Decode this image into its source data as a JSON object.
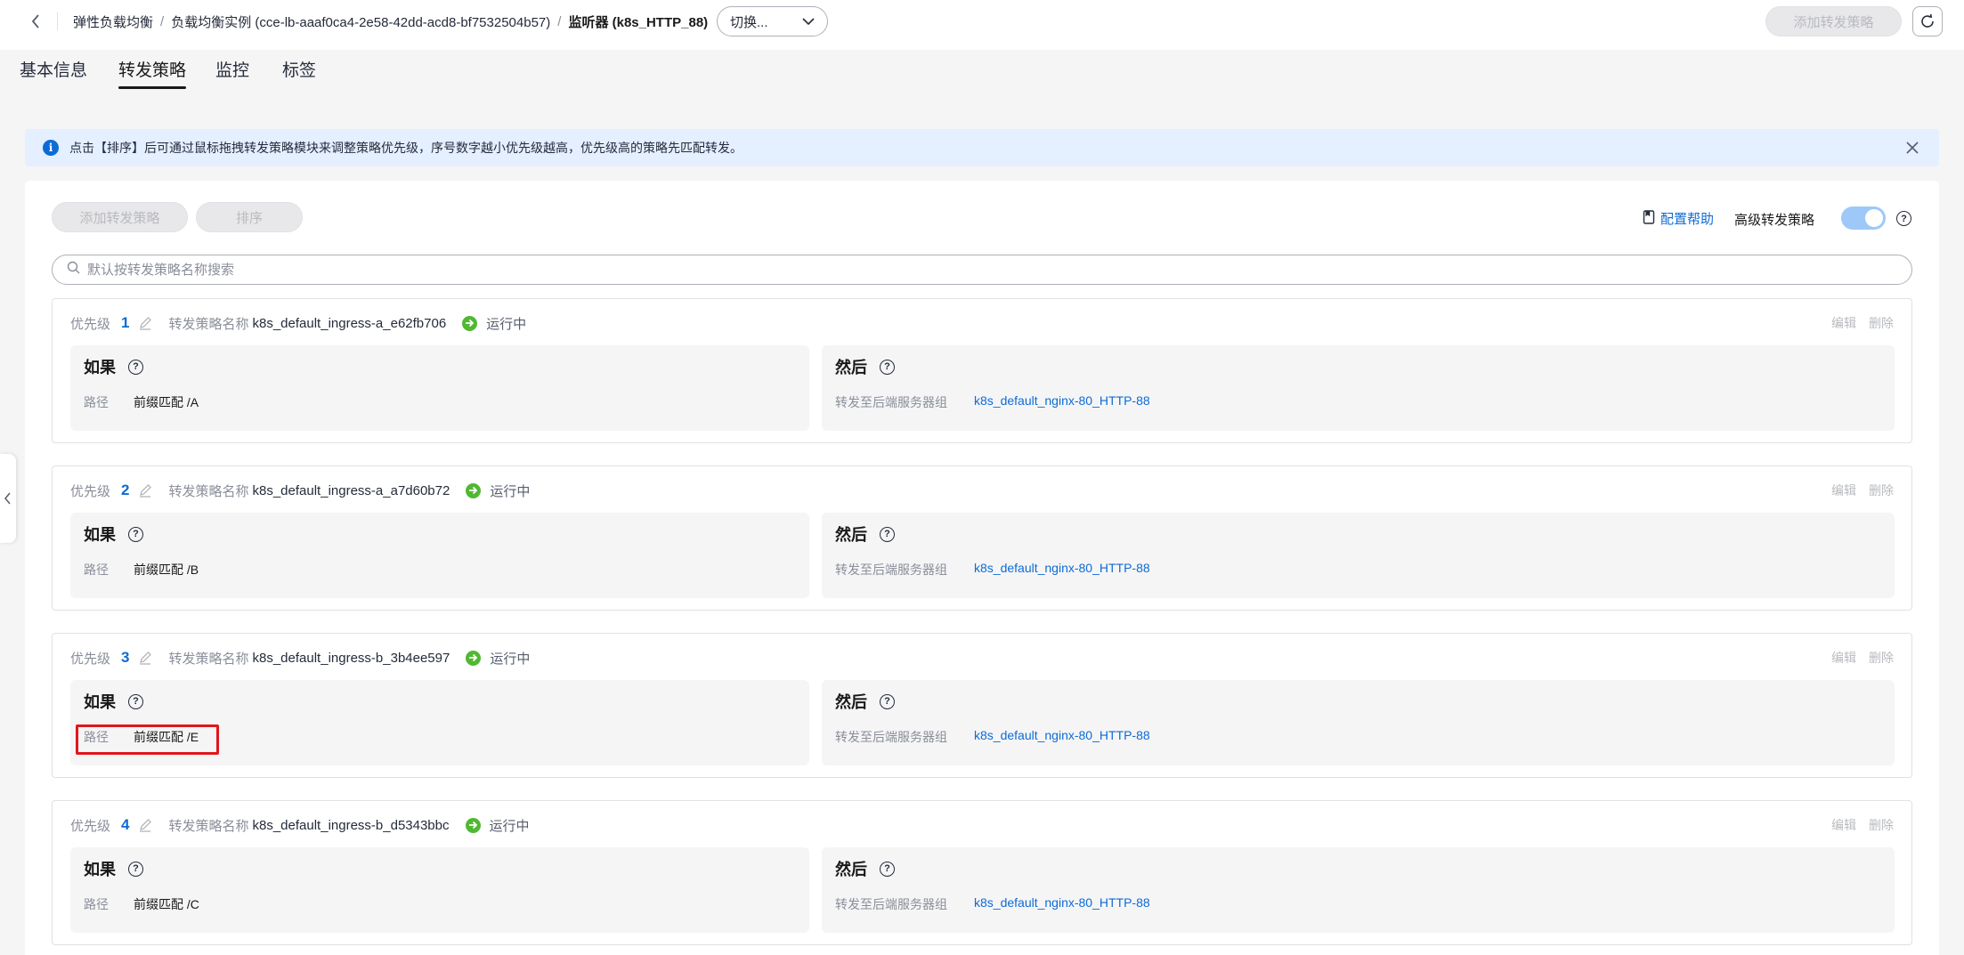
{
  "breadcrumb": {
    "items": [
      "弹性负载均衡",
      "负载均衡实例 (cce-lb-aaaf0ca4-2e58-42dd-acd8-bf7532504b57)"
    ],
    "current": "监听器 (k8s_HTTP_88)",
    "separator": "/"
  },
  "switcher": {
    "label": "切换..."
  },
  "top_actions": {
    "add_policy": "添加转发策略"
  },
  "tabs": [
    {
      "label": "基本信息",
      "active": false
    },
    {
      "label": "转发策略",
      "active": true
    },
    {
      "label": "监控",
      "active": false
    },
    {
      "label": "标签",
      "active": false
    }
  ],
  "notice": {
    "text": "点击【排序】后可通过鼠标拖拽转发策略模块来调整策略优先级，序号数字越小优先级越高，优先级高的策略先匹配转发。"
  },
  "toolbar": {
    "add_policy": "添加转发策略",
    "sort": "排序",
    "help": "配置帮助",
    "advanced": "高级转发策略",
    "advanced_enabled": true
  },
  "search": {
    "placeholder": "默认按转发策略名称搜索"
  },
  "labels": {
    "priority": "优先级",
    "policy_name": "转发策略名称",
    "edit": "编辑",
    "delete": "删除",
    "if": "如果",
    "then": "然后",
    "path": "路径",
    "forward_to": "转发至后端服务器组"
  },
  "policies": [
    {
      "priority": "1",
      "name": "k8s_default_ingress-a_e62fb706",
      "status": "运行中",
      "path": "前缀匹配 /A",
      "group": "k8s_default_nginx-80_HTTP-88"
    },
    {
      "priority": "2",
      "name": "k8s_default_ingress-a_a7d60b72",
      "status": "运行中",
      "path": "前缀匹配 /B",
      "group": "k8s_default_nginx-80_HTTP-88"
    },
    {
      "priority": "3",
      "name": "k8s_default_ingress-b_3b4ee597",
      "status": "运行中",
      "path": "前缀匹配 /E",
      "group": "k8s_default_nginx-80_HTTP-88"
    },
    {
      "priority": "4",
      "name": "k8s_default_ingress-b_d5343bbc",
      "status": "运行中",
      "path": "前缀匹配 /C",
      "group": "k8s_default_nginx-80_HTTP-88"
    }
  ],
  "colors": {
    "accent": "#0d6bd6",
    "running": "#50b832",
    "highlight": "#e0161c"
  }
}
